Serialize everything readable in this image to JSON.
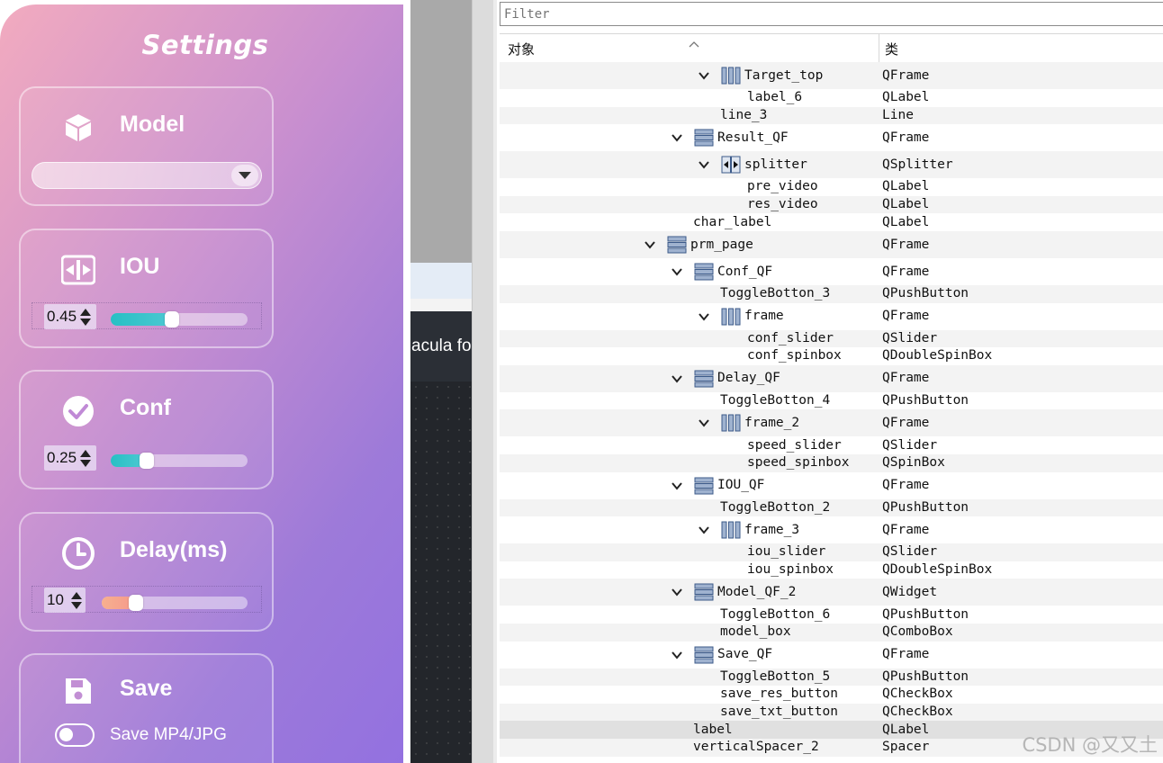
{
  "settings": {
    "title": "Settings",
    "model": {
      "label": "Model",
      "combo_value": ""
    },
    "iou": {
      "label": "IOU",
      "spin_value": "0.45",
      "slider_fraction": 0.45
    },
    "conf": {
      "label": "Conf",
      "spin_value": "0.25",
      "slider_fraction": 0.25
    },
    "delay": {
      "label": "Delay(ms)",
      "spin_value": "10",
      "slider_fraction": 0.2
    },
    "save": {
      "label": "Save",
      "toggle_label": "Save MP4/JPG",
      "toggle_on": false
    },
    "icons": [
      "cube-icon",
      "compress-icon",
      "check-circle-icon",
      "clock-icon",
      "floppy-disk-icon"
    ],
    "colors": {
      "iou_fill": "#2fc3c9",
      "conf_fill": "#2fc3c9",
      "delay_fill": "#f5a58a"
    }
  },
  "middle": {
    "partial_text": "acula fo"
  },
  "inspector": {
    "filter_placeholder": "Filter",
    "columns": {
      "object": "对象",
      "class": "类"
    },
    "rows": [
      {
        "name": "Target_top",
        "cls": "QFrame",
        "depth": 4,
        "expand": true,
        "icon": "hframe"
      },
      {
        "name": "label_6",
        "cls": "QLabel",
        "depth": 5,
        "expand": false,
        "icon": ""
      },
      {
        "name": "line_3",
        "cls": "Line",
        "depth": 4,
        "expand": false,
        "icon": ""
      },
      {
        "name": "Result_QF",
        "cls": "QFrame",
        "depth": 3,
        "expand": true,
        "icon": "vframe"
      },
      {
        "name": "splitter",
        "cls": "QSplitter",
        "depth": 4,
        "expand": true,
        "icon": "splitter"
      },
      {
        "name": "pre_video",
        "cls": "QLabel",
        "depth": 5,
        "expand": false,
        "icon": ""
      },
      {
        "name": "res_video",
        "cls": "QLabel",
        "depth": 5,
        "expand": false,
        "icon": ""
      },
      {
        "name": "char_label",
        "cls": "QLabel",
        "depth": 3,
        "expand": false,
        "icon": ""
      },
      {
        "name": "prm_page",
        "cls": "QFrame",
        "depth": 2,
        "expand": true,
        "icon": "vframe"
      },
      {
        "name": "Conf_QF",
        "cls": "QFrame",
        "depth": 3,
        "expand": true,
        "icon": "vframe"
      },
      {
        "name": "ToggleBotton_3",
        "cls": "QPushButton",
        "depth": 4,
        "expand": false,
        "icon": ""
      },
      {
        "name": "frame",
        "cls": "QFrame",
        "depth": 4,
        "expand": true,
        "icon": "hframe"
      },
      {
        "name": "conf_slider",
        "cls": "QSlider",
        "depth": 5,
        "expand": false,
        "icon": ""
      },
      {
        "name": "conf_spinbox",
        "cls": "QDoubleSpinBox",
        "depth": 5,
        "expand": false,
        "icon": ""
      },
      {
        "name": "Delay_QF",
        "cls": "QFrame",
        "depth": 3,
        "expand": true,
        "icon": "vframe"
      },
      {
        "name": "ToggleBotton_4",
        "cls": "QPushButton",
        "depth": 4,
        "expand": false,
        "icon": ""
      },
      {
        "name": "frame_2",
        "cls": "QFrame",
        "depth": 4,
        "expand": true,
        "icon": "hframe"
      },
      {
        "name": "speed_slider",
        "cls": "QSlider",
        "depth": 5,
        "expand": false,
        "icon": ""
      },
      {
        "name": "speed_spinbox",
        "cls": "QSpinBox",
        "depth": 5,
        "expand": false,
        "icon": ""
      },
      {
        "name": "IOU_QF",
        "cls": "QFrame",
        "depth": 3,
        "expand": true,
        "icon": "vframe"
      },
      {
        "name": "ToggleBotton_2",
        "cls": "QPushButton",
        "depth": 4,
        "expand": false,
        "icon": ""
      },
      {
        "name": "frame_3",
        "cls": "QFrame",
        "depth": 4,
        "expand": true,
        "icon": "hframe"
      },
      {
        "name": "iou_slider",
        "cls": "QSlider",
        "depth": 5,
        "expand": false,
        "icon": ""
      },
      {
        "name": "iou_spinbox",
        "cls": "QDoubleSpinBox",
        "depth": 5,
        "expand": false,
        "icon": ""
      },
      {
        "name": "Model_QF_2",
        "cls": "QWidget",
        "depth": 3,
        "expand": true,
        "icon": "vframe"
      },
      {
        "name": "ToggleBotton_6",
        "cls": "QPushButton",
        "depth": 4,
        "expand": false,
        "icon": ""
      },
      {
        "name": "model_box",
        "cls": "QComboBox",
        "depth": 4,
        "expand": false,
        "icon": ""
      },
      {
        "name": "Save_QF",
        "cls": "QFrame",
        "depth": 3,
        "expand": true,
        "icon": "vframe"
      },
      {
        "name": "ToggleBotton_5",
        "cls": "QPushButton",
        "depth": 4,
        "expand": false,
        "icon": ""
      },
      {
        "name": "save_res_button",
        "cls": "QCheckBox",
        "depth": 4,
        "expand": false,
        "icon": ""
      },
      {
        "name": "save_txt_button",
        "cls": "QCheckBox",
        "depth": 4,
        "expand": false,
        "icon": ""
      },
      {
        "name": "label",
        "cls": "QLabel",
        "depth": 3,
        "expand": false,
        "icon": "",
        "selected": true
      },
      {
        "name": "verticalSpacer_2",
        "cls": "Spacer",
        "depth": 3,
        "expand": false,
        "icon": ""
      }
    ]
  },
  "watermark": "CSDN @又又土"
}
